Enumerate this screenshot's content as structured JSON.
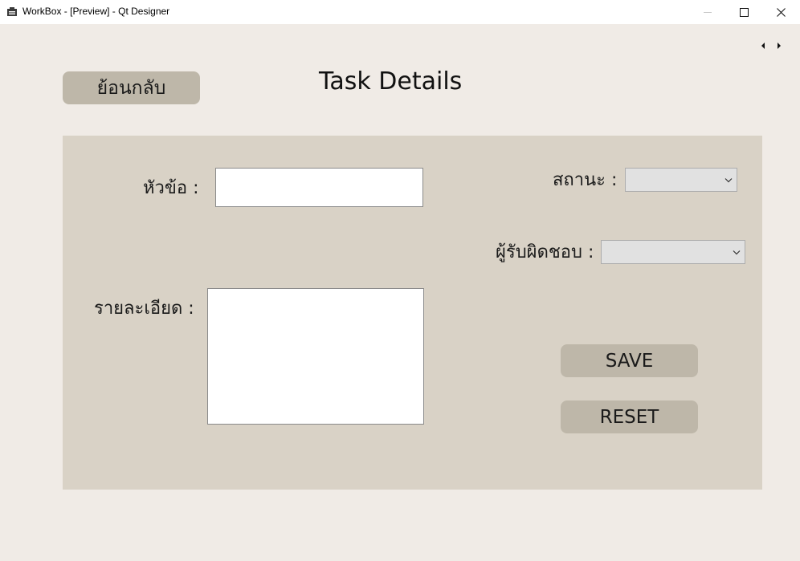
{
  "window": {
    "title": "WorkBox - [Preview] - Qt Designer",
    "app_icon": "qt-designer-icon",
    "controls": {
      "minimize_icon": "minimize-icon",
      "maximize_icon": "maximize-icon",
      "close_icon": "close-icon"
    }
  },
  "scroll_arrows": {
    "left_icon": "arrow-left-icon",
    "right_icon": "arrow-right-icon"
  },
  "header": {
    "back_label": "ย้อนกลับ",
    "title": "Task Details"
  },
  "form": {
    "topic_label": "หัวข้อ :",
    "topic_value": "",
    "detail_label": "รายละเอียด :",
    "detail_value": "",
    "status_label": "สถานะ :",
    "status_value": "",
    "owner_label": "ผู้รับผิดชอบ :",
    "owner_value": ""
  },
  "actions": {
    "save_label": "SAVE",
    "reset_label": "RESET"
  },
  "colors": {
    "window_bg": "#f0ebe6",
    "panel_bg": "#d9d2c6",
    "button_bg": "#beb7a9",
    "titlebar_bg": "#ffffff"
  }
}
